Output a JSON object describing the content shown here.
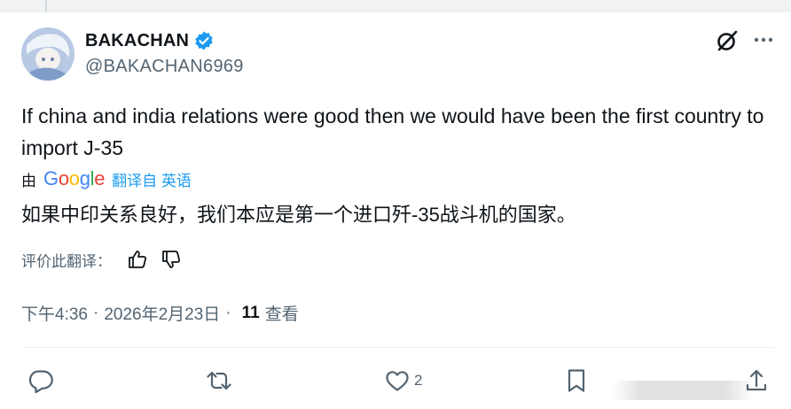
{
  "author": {
    "display_name": "BAKACHAN",
    "handle": "@BAKACHAN6969",
    "verified": true,
    "verified_color": "#1d9bf0"
  },
  "tweet": {
    "text": "If china and india relations were good then we would have been the first country to import J-35",
    "translated_by_label": "由",
    "google_letters": [
      "G",
      "o",
      "o",
      "g",
      "l",
      "e"
    ],
    "translate_link": "翻译自 英语",
    "translated_text": "如果中印关系良好，我们本应是第一个进口歼-35战斗机的国家。",
    "rate_label": "评价此翻译：",
    "time": "下午4:36",
    "date": "2026年2月23日",
    "separator": "·",
    "views_count": "11",
    "views_label": "查看"
  },
  "actions": {
    "reply_count": "",
    "retweet_count": "",
    "like_count": "2",
    "bookmark_count": ""
  },
  "icons": [
    "grok-icon",
    "more-icon",
    "verified-badge-icon",
    "thumbs-up-icon",
    "thumbs-down-icon",
    "reply-icon",
    "retweet-icon",
    "like-icon",
    "bookmark-icon",
    "share-icon"
  ],
  "colors": {
    "text_primary": "#0f1419",
    "text_secondary": "#536471",
    "accent": "#1d9bf0"
  }
}
